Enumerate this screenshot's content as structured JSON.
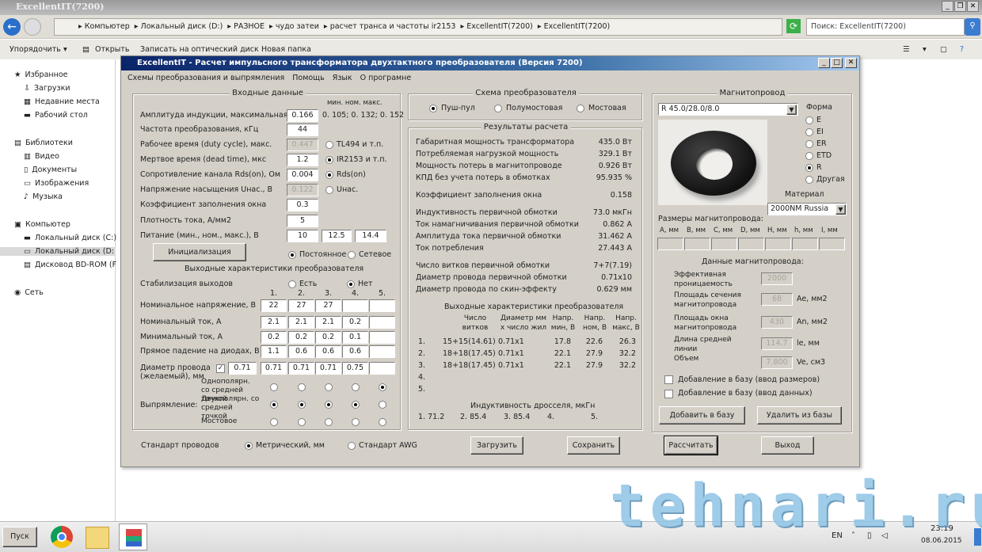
{
  "window": {
    "title": "ExcellentIT(7200)"
  },
  "address": {
    "crumbs": [
      "Компьютер",
      "Локальный диск  (D:)",
      "РАЗНОЕ",
      "чудо затеи",
      "расчет транса и частоты ir2153",
      "ExcellentIT(7200)",
      "ExcellentIT(7200)"
    ],
    "search_placeholder": "Поиск: ExcellentIT(7200)"
  },
  "toolbar": {
    "organize": "Упорядочить",
    "open": "Открыть",
    "burn": "Записать на оптический диск",
    "new_folder": "Новая папка"
  },
  "sidebar": {
    "items": [
      {
        "label": "Избранное",
        "icon": "★"
      },
      {
        "label": "Загрузки",
        "icon": "⇩"
      },
      {
        "label": "Недавние места",
        "icon": "▦"
      },
      {
        "label": "Рабочий стол",
        "icon": "▬"
      },
      {
        "label": "Библиотеки",
        "icon": "▤"
      },
      {
        "label": "Видео",
        "icon": "▥"
      },
      {
        "label": "Документы",
        "icon": "▯"
      },
      {
        "label": "Изображения",
        "icon": "▭"
      },
      {
        "label": "Музыка",
        "icon": "♪"
      },
      {
        "label": "Компьютер",
        "icon": "▣"
      },
      {
        "label": "Локальный диск (C:)",
        "icon": "▬"
      },
      {
        "label": "Локальный диск  (D:",
        "icon": "▭"
      },
      {
        "label": "Дисковод BD-ROM (F",
        "icon": "▤"
      },
      {
        "label": "Сеть",
        "icon": "◉"
      }
    ]
  },
  "dialog": {
    "title": "ExcellentIT - Расчет импульсного трансформатора двухтактного преобразователя (Версия 7200)",
    "menu": [
      "Схемы преобразования и выпрямления",
      "Помощь",
      "Язык",
      "О програмне"
    ],
    "input": {
      "title": "Входные данные",
      "hdr": "мин.   ном.   макс.",
      "range": "0. 105; 0. 132; 0. 152",
      "rows": [
        {
          "label": "Амплитуда индукции, максимальная, Т",
          "value": "0.166"
        },
        {
          "label": "Частота преобразования, кГц",
          "value": "44"
        },
        {
          "label": "Рабочее время (duty cycle), макс.",
          "value": "0.447"
        },
        {
          "label": "Мертвое время (dead time), мкс",
          "value": "1.2"
        },
        {
          "label": "Сопротивление канала Rds(on), Ом",
          "value": "0.004"
        },
        {
          "label": "Напряжение насыщения Uнас., В",
          "value": "0.122"
        },
        {
          "label": "Коэффициент заполнения окна",
          "value": "0.3"
        },
        {
          "label": "Плотность тока, А/мм2",
          "value": "5"
        },
        {
          "label": "Питание (мин., ном., макс.), В",
          "value": "10"
        }
      ],
      "supply_nom": "12.5",
      "supply_max": "14.4",
      "opt_tl494": "TL494 и т.п.",
      "opt_ir2153": "IR2153 и т.п.",
      "opt_rds": "Rds(on)",
      "opt_usat": "Uнас.",
      "init": "Инициализация",
      "dc": "Постоянное",
      "ac": "Сетевое"
    },
    "output": {
      "title": "Выходные характеристики преобразователя",
      "stab": "Стабилизация выходов",
      "yes": "Есть",
      "no": "Нет",
      "cols": [
        "1.",
        "2.",
        "3.",
        "4.",
        "5."
      ],
      "rows": [
        {
          "label": "Номинальное напряжение, В",
          "v": [
            "22",
            "27",
            "27",
            "",
            ""
          ]
        },
        {
          "label": "Номинальный ток, А",
          "v": [
            "2.1",
            "2.1",
            "2.1",
            "0.2",
            ""
          ]
        },
        {
          "label": "Минимальный ток, А",
          "v": [
            "0.2",
            "0.2",
            "0.2",
            "0.1",
            ""
          ]
        },
        {
          "label": "Прямое падение на диодах, В",
          "v": [
            "1.1",
            "0.6",
            "0.6",
            "0.6",
            ""
          ]
        },
        {
          "label": "Диаметр провода (желаемый), мм",
          "v": [
            "0.71",
            "0.71",
            "0.71",
            "0.75",
            ""
          ]
        }
      ],
      "wire_default": "0.71",
      "rect_label": "Выпрямление:",
      "rect": [
        "Однополярн. со средней точкой",
        "Двухполярн. со средней точкой",
        "Мостовое"
      ],
      "rect_sel": [
        1,
        1,
        1,
        1,
        0
      ]
    },
    "scheme": {
      "title": "Схема преобразователя",
      "opts": [
        "Пуш-пул",
        "Полумостовая",
        "Мостовая"
      ]
    },
    "results": {
      "title": "Результаты расчета",
      "rows": [
        {
          "label": "Габаритная мощность трансформатора",
          "value": "435.0 Вт"
        },
        {
          "label": "Потребляемая нагрузкой мощность",
          "value": "329.1 Вт"
        },
        {
          "label": "Мощность потерь в магнитопроводе",
          "value": "0.926 Вт"
        },
        {
          "label": "КПД без учета потерь в обмотках",
          "value": "95.935 %"
        },
        {
          "label": "Коэффициент заполнения окна",
          "value": "0.158"
        },
        {
          "label": "Индуктивность первичной обмотки",
          "value": "73.0 мкГн"
        },
        {
          "label": "Ток намагничивания первичной обмотки",
          "value": "0.862 А"
        },
        {
          "label": "Амплитуда тока первичной обмотки",
          "value": "31.462 А"
        },
        {
          "label": "Ток потребления",
          "value": "27.443 А"
        },
        {
          "label": "Число витков первичной обмотки",
          "value": "7+7(7.19)"
        },
        {
          "label": "Диаметр провода первичной обмотки",
          "value": "0.71x10"
        },
        {
          "label": "Диаметр провода по скин-эффекту",
          "value": "0.629 мм"
        }
      ],
      "out_title": "Выходные характеристики преобразователя",
      "out_hdr": [
        "Число витков",
        "Диаметр мм х число жил",
        "Напр. мин, В",
        "Напр. ном, В",
        "Напр. макс, В"
      ],
      "out_rows": [
        [
          "1.",
          "15+15(14.61)",
          "0.71x1",
          "17.8",
          "22.6",
          "26.3"
        ],
        [
          "2.",
          "18+18(17.45)",
          "0.71x1",
          "22.1",
          "27.9",
          "32.2"
        ],
        [
          "3.",
          "18+18(17.45)",
          "0.71x1",
          "22.1",
          "27.9",
          "32.2"
        ],
        [
          "4.",
          "",
          "",
          "",
          "",
          ""
        ],
        [
          "5.",
          "",
          "",
          "",
          "",
          ""
        ]
      ],
      "ind_title": "Индуктивность дросселя, мкГн",
      "ind": [
        "1. 71.2",
        "2. 85.4",
        "3. 85.4",
        "4.",
        "5."
      ]
    },
    "core": {
      "title": "Магнитопровод",
      "selected": "R 45.0/28.0/8.0",
      "shape_label": "Форма",
      "shapes": [
        "E",
        "EI",
        "ER",
        "ETD",
        "R",
        "Другая"
      ],
      "shape_sel": 4,
      "material_label": "Материал",
      "material": "2000NM Russia",
      "dims_label": "Размеры магнитопровода:",
      "dims": [
        "A, мм",
        "B, мм",
        "C, мм",
        "D, мм",
        "H, мм",
        "h, мм",
        "I, мм"
      ],
      "data_label": "Данные магнитопровода:",
      "params": [
        {
          "label": "Эффективная проницаемость",
          "value": "2000",
          "unit": ""
        },
        {
          "label": "Площадь сечения магнитопровода",
          "value": "68",
          "unit": "Ae, мм2"
        },
        {
          "label": "Площадь окна магнитопровода",
          "value": "430",
          "unit": "An, мм2"
        },
        {
          "label": "Длина средней линии",
          "value": "114.7",
          "unit": "le, мм"
        },
        {
          "label": "Объем",
          "value": "7.800",
          "unit": "Ve, см3"
        }
      ],
      "chk1": "Добавление в базу (ввод размеров)",
      "chk2": "Добавление в базу (ввод данных)",
      "add": "Добавить в базу",
      "del": "Удалить из базы"
    },
    "bottom": {
      "std": "Стандарт проводов",
      "metric": "Метрический, мм",
      "awg": "Стандарт AWG",
      "load": "Загрузить",
      "save": "Сохранить",
      "calc": "Рассчитать",
      "exit": "Выход"
    }
  },
  "taskbar": {
    "start": "Пуск",
    "lang": "EN",
    "time": "23:19",
    "date": "08.06.2015"
  },
  "watermark": "tehnari.ru"
}
